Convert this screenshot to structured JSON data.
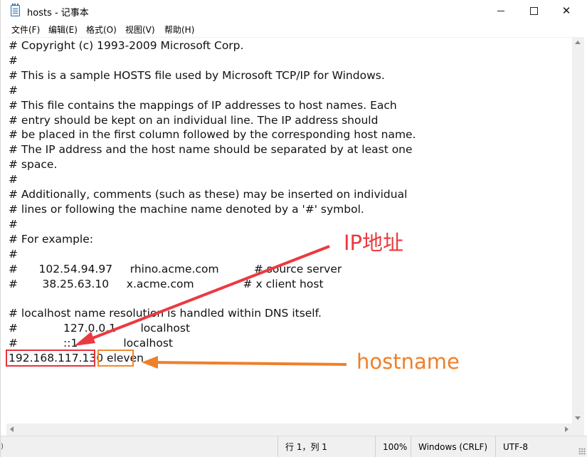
{
  "window": {
    "title": "hosts - 记事本",
    "minimize_glyph": "",
    "maximize_glyph": "",
    "close_glyph": "✕"
  },
  "menu": [
    {
      "label": "文件(F)"
    },
    {
      "label": "编辑(E)"
    },
    {
      "label": "格式(O)"
    },
    {
      "label": "视图(V)"
    },
    {
      "label": "帮助(H)"
    }
  ],
  "editor": {
    "text": "# Copyright (c) 1993-2009 Microsoft Corp.\n#\n# This is a sample HOSTS file used by Microsoft TCP/IP for Windows.\n#\n# This file contains the mappings of IP addresses to host names. Each\n# entry should be kept on an individual line. The IP address should\n# be placed in the first column followed by the corresponding host name.\n# The IP address and the host name should be separated by at least one\n# space.\n#\n# Additionally, comments (such as these) may be inserted on individual\n# lines or following the machine name denoted by a '#' symbol.\n#\n# For example:\n#\n#      102.54.94.97     rhino.acme.com          # source server\n#       38.25.63.10     x.acme.com              # x client host\n\n# localhost name resolution is handled within DNS itself.\n#             127.0.0.1       localhost\n#             ::1             localhost\n192.168.117.130 eleven"
  },
  "status": {
    "position": "行 1，列 1",
    "zoom": "100%",
    "line_ending": "Windows (CRLF)",
    "encoding": "UTF-8"
  },
  "annotations": {
    "ip_label": "IP地址",
    "host_label": "hostname",
    "ip_color": "#ea3a40",
    "host_color": "#f07f2a"
  },
  "side_glyph": ")"
}
